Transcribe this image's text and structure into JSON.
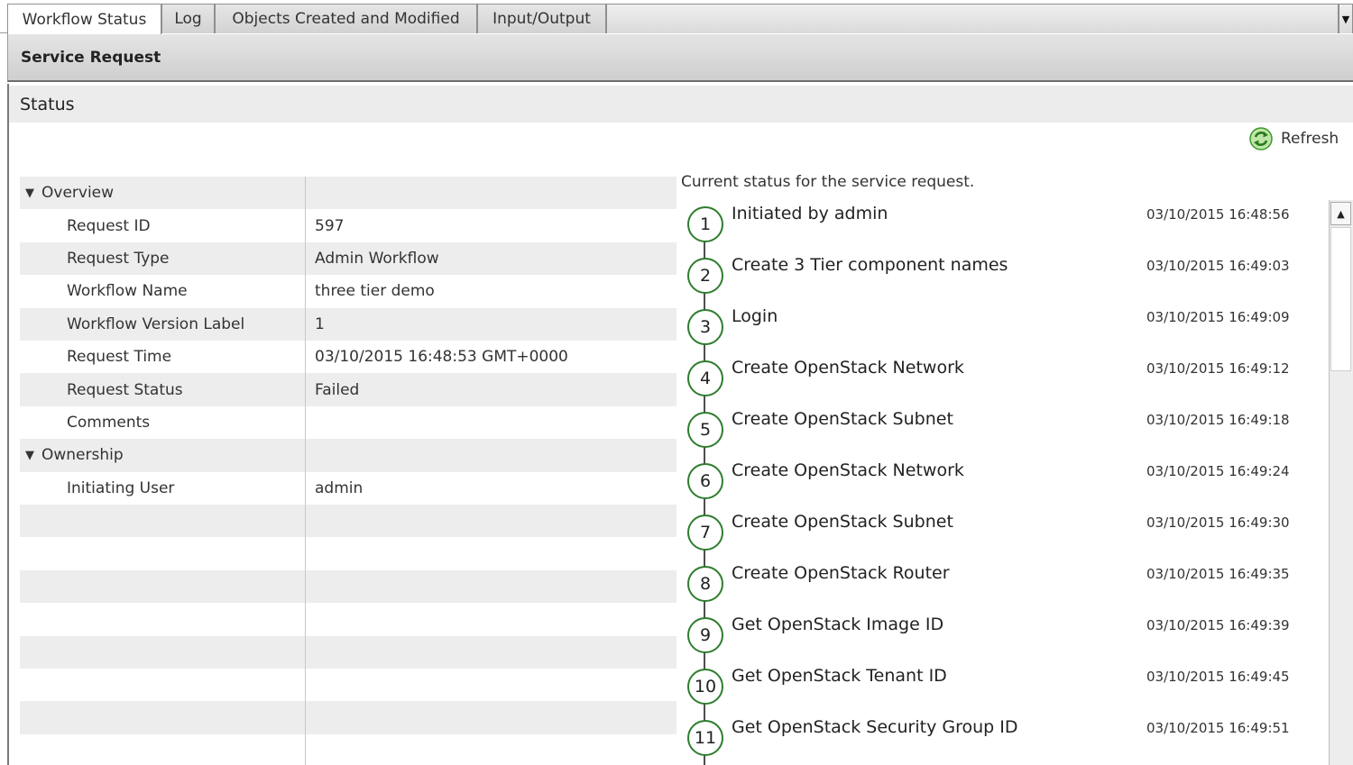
{
  "tabs": [
    {
      "label": "Workflow Status"
    },
    {
      "label": "Log"
    },
    {
      "label": "Objects Created and Modified"
    },
    {
      "label": "Input/Output"
    }
  ],
  "tab_dropdown_glyph": "▼",
  "header": {
    "title": "Service Request"
  },
  "status_bar": {
    "label": "Status"
  },
  "refresh": {
    "label": "Refresh",
    "icon": "refresh-icon"
  },
  "overview": {
    "group_label": "Overview",
    "rows": [
      {
        "label": "Request ID",
        "value": "597"
      },
      {
        "label": "Request Type",
        "value": "Admin Workflow"
      },
      {
        "label": "Workflow Name",
        "value": "three tier demo"
      },
      {
        "label": "Workflow Version Label",
        "value": "1"
      },
      {
        "label": "Request Time",
        "value": "03/10/2015 16:48:53 GMT+0000"
      },
      {
        "label": "Request Status",
        "value": "Failed"
      },
      {
        "label": "Comments",
        "value": ""
      }
    ]
  },
  "ownership": {
    "group_label": "Ownership",
    "rows": [
      {
        "label": "Initiating User",
        "value": "admin"
      }
    ]
  },
  "timeline": {
    "caption": "Current status for the service request.",
    "steps": [
      {
        "num": "1",
        "name": "Initiated by admin",
        "time": "03/10/2015 16:48:56"
      },
      {
        "num": "2",
        "name": "Create 3 Tier component names",
        "time": "03/10/2015 16:49:03"
      },
      {
        "num": "3",
        "name": "Login",
        "time": "03/10/2015 16:49:09"
      },
      {
        "num": "4",
        "name": "Create OpenStack Network",
        "time": "03/10/2015 16:49:12"
      },
      {
        "num": "5",
        "name": "Create OpenStack Subnet",
        "time": "03/10/2015 16:49:18"
      },
      {
        "num": "6",
        "name": "Create OpenStack Network",
        "time": "03/10/2015 16:49:24"
      },
      {
        "num": "7",
        "name": "Create OpenStack Subnet",
        "time": "03/10/2015 16:49:30"
      },
      {
        "num": "8",
        "name": "Create OpenStack Router",
        "time": "03/10/2015 16:49:35"
      },
      {
        "num": "9",
        "name": "Get OpenStack Image ID",
        "time": "03/10/2015 16:49:39"
      },
      {
        "num": "10",
        "name": "Get OpenStack Tenant ID",
        "time": "03/10/2015 16:49:45"
      },
      {
        "num": "11",
        "name": "Get OpenStack Security Group ID",
        "time": "03/10/2015 16:49:51"
      }
    ]
  },
  "scrollbar": {
    "up_glyph": "▲"
  },
  "colors": {
    "step_circle_border": "#2e7d2e",
    "refresh_icon": "#3a9a2a"
  }
}
